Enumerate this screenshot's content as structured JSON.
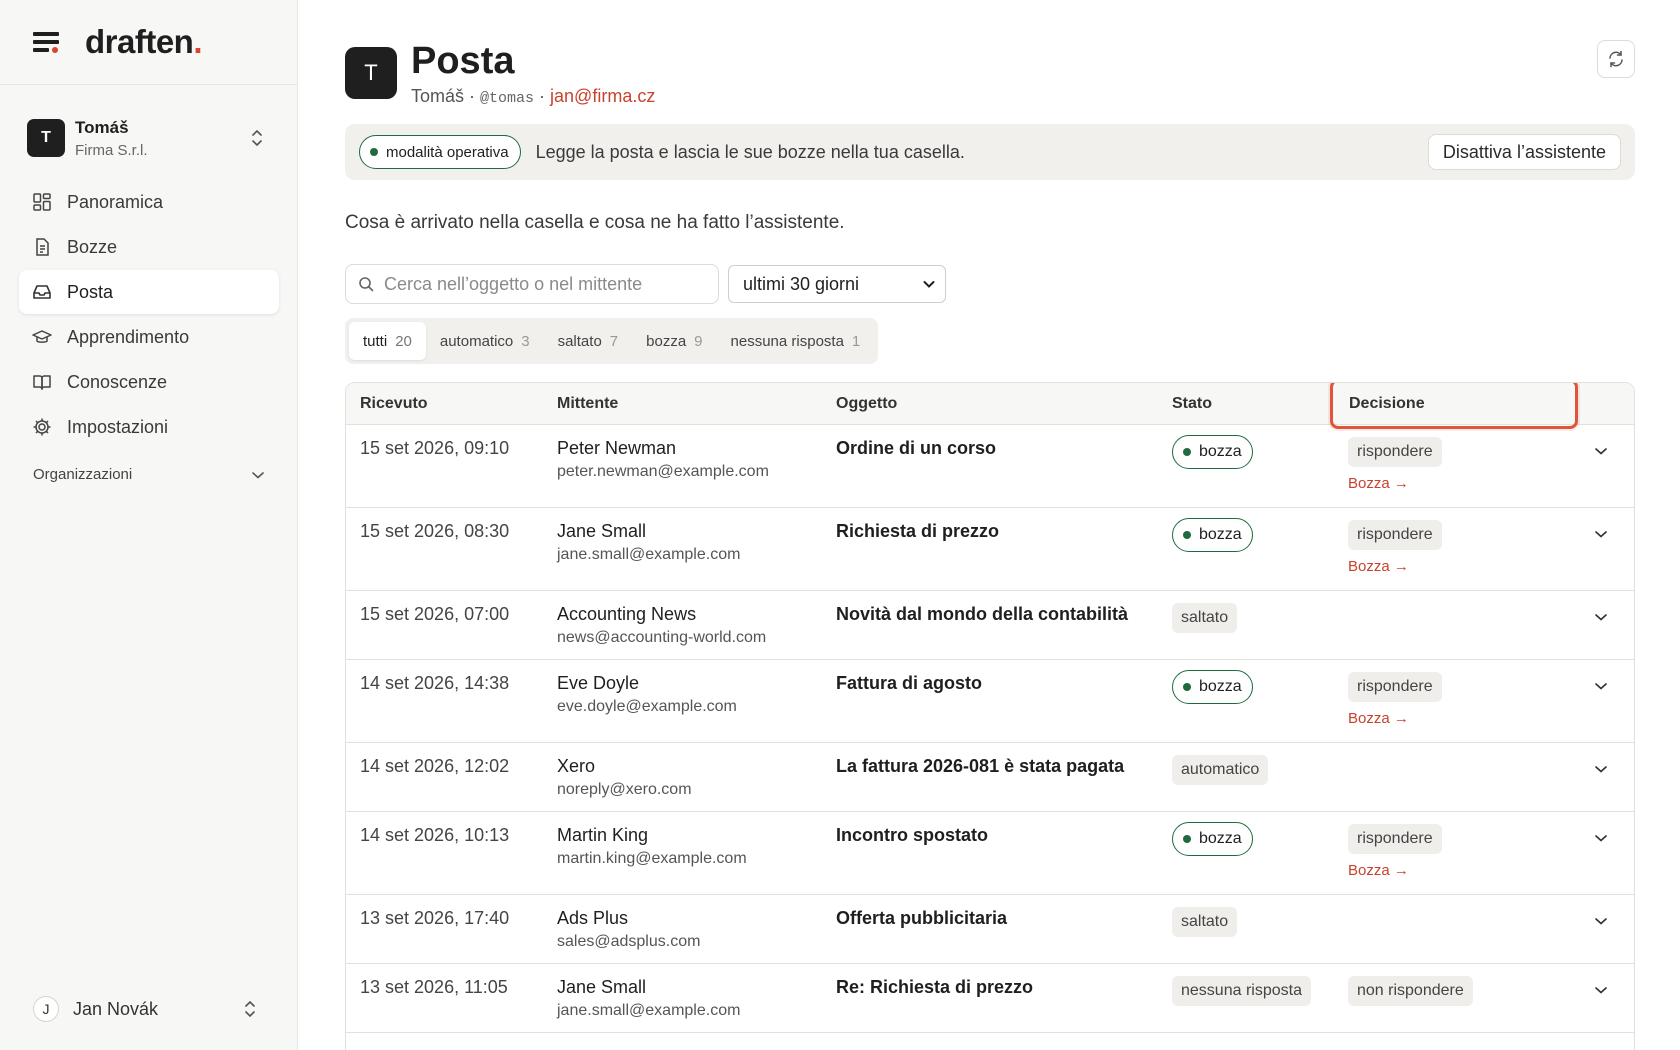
{
  "brand": {
    "name": "draften",
    "dot": "."
  },
  "workspace": {
    "initial": "T",
    "name": "Tomáš",
    "org": "Firma S.r.l."
  },
  "nav": [
    {
      "label": "Panoramica",
      "icon": "dashboard-icon"
    },
    {
      "label": "Bozze",
      "icon": "document-icon"
    },
    {
      "label": "Posta",
      "icon": "inbox-icon",
      "active": true
    },
    {
      "label": "Apprendimento",
      "icon": "graduation-cap-icon"
    },
    {
      "label": "Conoscenze",
      "icon": "book-icon"
    },
    {
      "label": "Impostazioni",
      "icon": "gear-icon"
    }
  ],
  "nav_section": {
    "label": "Organizzazioni"
  },
  "user": {
    "initial": "J",
    "name": "Jan Novák"
  },
  "header": {
    "initial": "T",
    "title": "Posta",
    "name": "Tomáš",
    "sep1": " · ",
    "handle": "@tomas",
    "sep2": " · ",
    "email": "jan@firma.cz"
  },
  "banner": {
    "mode": "modalità operativa",
    "text": "Legge la posta e lascia le sue bozze nella tua casella.",
    "button": "Disattiva l’assistente"
  },
  "intro": "Cosa è arrivato nella casella e cosa ne ha fatto l’assistente.",
  "search": {
    "placeholder": "Cerca nell’oggetto o nel mittente",
    "value": ""
  },
  "period": {
    "selected": "ultimi 30 giorni"
  },
  "filters": [
    {
      "label": "tutti",
      "count": "20",
      "active": true
    },
    {
      "label": "automatico",
      "count": "3"
    },
    {
      "label": "saltato",
      "count": "7"
    },
    {
      "label": "bozza",
      "count": "9"
    },
    {
      "label": "nessuna risposta",
      "count": "1"
    }
  ],
  "table": {
    "columns": {
      "received": "Ricevuto",
      "sender": "Mittente",
      "subject": "Oggetto",
      "status": "Stato",
      "decision": "Decisione"
    },
    "rows": [
      {
        "date": "15 set 2026, 09:10",
        "sender": "Peter Newman",
        "email": "peter.newman@example.com",
        "subject": "Ordine di un corso",
        "status": "bozza",
        "decision": "rispondere",
        "link": "Bozza →"
      },
      {
        "date": "15 set 2026, 08:30",
        "sender": "Jane Small",
        "email": "jane.small@example.com",
        "subject": "Richiesta di prezzo",
        "status": "bozza",
        "decision": "rispondere",
        "link": "Bozza →"
      },
      {
        "date": "15 set 2026, 07:00",
        "sender": "Accounting News",
        "email": "news@accounting-world.com",
        "subject": "Novità dal mondo della contabilità",
        "status": "saltato",
        "decision": "",
        "link": ""
      },
      {
        "date": "14 set 2026, 14:38",
        "sender": "Eve Doyle",
        "email": "eve.doyle@example.com",
        "subject": "Fattura di agosto",
        "status": "bozza",
        "decision": "rispondere",
        "link": "Bozza →"
      },
      {
        "date": "14 set 2026, 12:02",
        "sender": "Xero",
        "email": "noreply@xero.com",
        "subject": "La fattura 2026-081 è stata pagata",
        "status": "automatico",
        "decision": "",
        "link": ""
      },
      {
        "date": "14 set 2026, 10:13",
        "sender": "Martin King",
        "email": "martin.king@example.com",
        "subject": "Incontro spostato",
        "status": "bozza",
        "decision": "rispondere",
        "link": "Bozza →"
      },
      {
        "date": "13 set 2026, 17:40",
        "sender": "Ads Plus",
        "email": "sales@adsplus.com",
        "subject": "Offerta pubblicitaria",
        "status": "saltato",
        "decision": "",
        "link": ""
      },
      {
        "date": "13 set 2026, 11:05",
        "sender": "Jane Small",
        "email": "jane.small@example.com",
        "subject": "Re: Richiesta di prezzo",
        "status": "nessuna risposta",
        "decision": "non rispondere",
        "link": ""
      }
    ]
  },
  "colors": {
    "accent": "#d9452f",
    "link": "#c8432d",
    "green": "#1f6b3f",
    "highlight": "#e0543b"
  }
}
